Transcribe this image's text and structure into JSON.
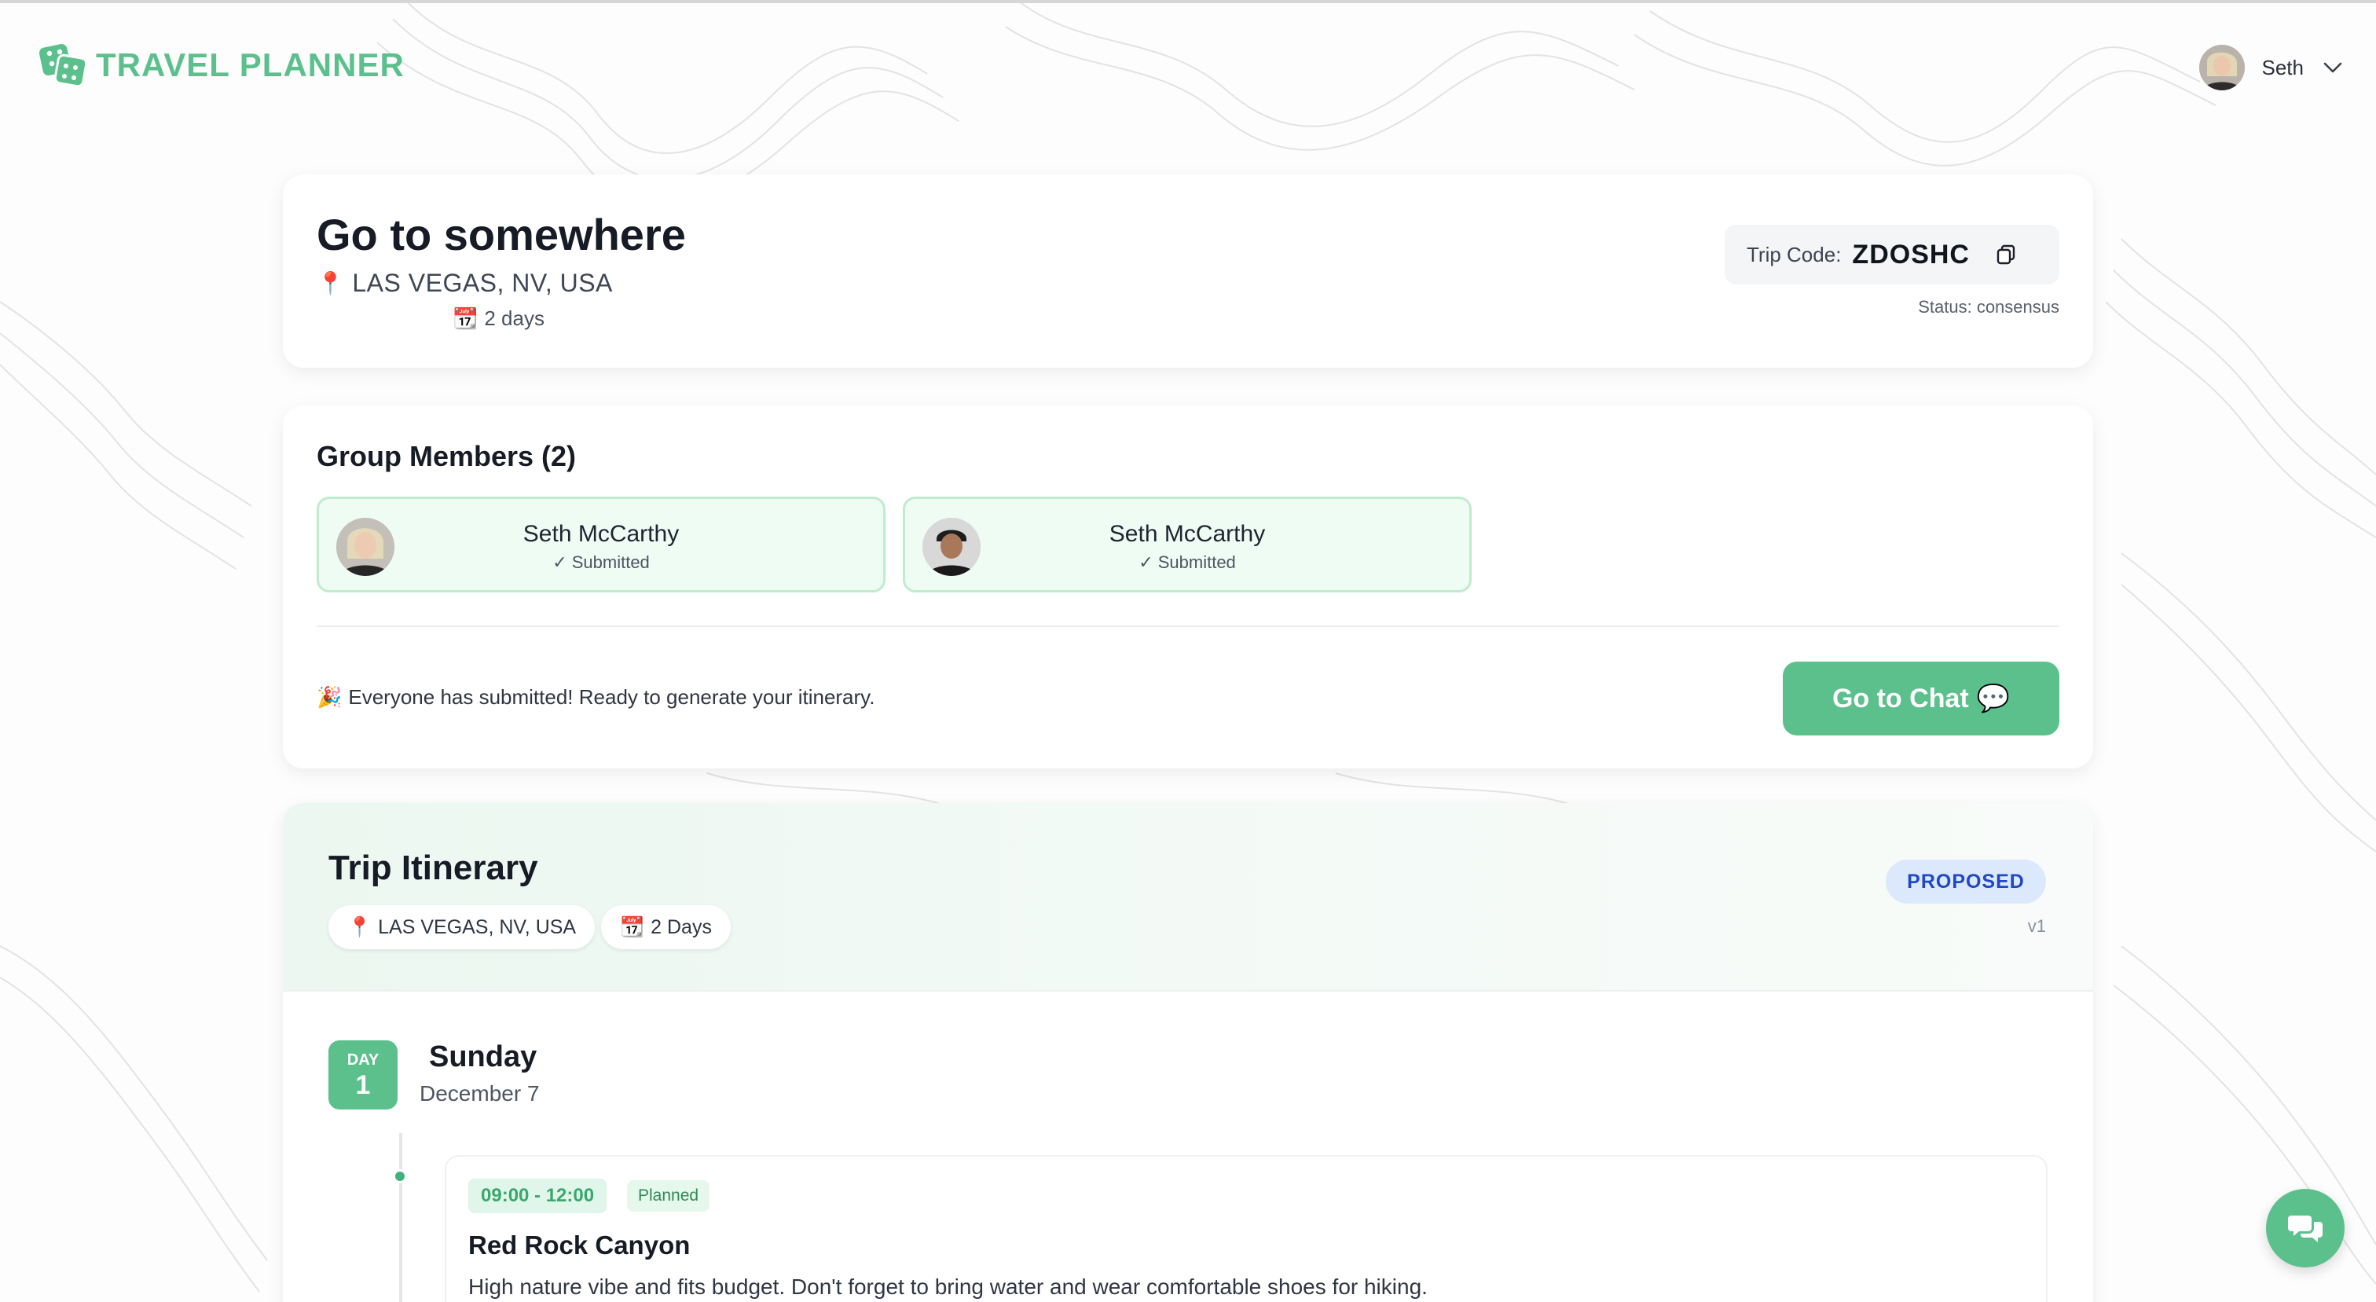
{
  "header": {
    "brand": "TRAVEL PLANNER",
    "user_name": "Seth"
  },
  "trip": {
    "title": "Go to somewhere",
    "location": "LAS VEGAS, NV, USA",
    "duration": "2 days",
    "code_label": "Trip Code:",
    "code": "ZDOSHC",
    "status": "Status: consensus"
  },
  "members": {
    "title": "Group Members (2)",
    "items": [
      {
        "name": "Seth McCarthy",
        "status": "✓ Submitted"
      },
      {
        "name": "Seth McCarthy",
        "status": "✓ Submitted"
      }
    ],
    "ready_message": "Everyone has submitted! Ready to generate your itinerary.",
    "chat_button": "Go to Chat"
  },
  "itinerary": {
    "title": "Trip Itinerary",
    "location_chip": "LAS VEGAS, NV, USA",
    "days_chip": "2 Days",
    "status_badge": "PROPOSED",
    "version": "v1",
    "days": [
      {
        "label": "DAY",
        "number": "1",
        "weekday": "Sunday",
        "date": "December 7",
        "activities": [
          {
            "time": "09:00 - 12:00",
            "state": "Planned",
            "name": "Red Rock Canyon",
            "description": "High nature vibe and fits budget. Don't forget to bring water and wear comfortable shoes for hiking."
          }
        ]
      }
    ]
  },
  "colors": {
    "accent": "#5cc08d",
    "member_bg": "#eefcf3",
    "badge_blue": "#2148c3"
  },
  "icons": {
    "brand": "dice-icon",
    "location": "pin-icon",
    "calendar": "calendar-icon",
    "copy": "copy-icon",
    "party": "party-popper-icon",
    "chat": "speech-bubble-icon",
    "fab": "chat-bubbles-icon"
  }
}
